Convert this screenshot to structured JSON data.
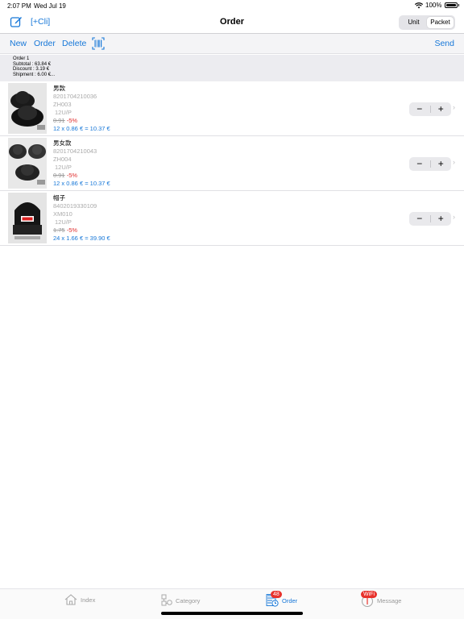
{
  "status": {
    "time": "2:07 PM",
    "date": "Wed Jul 19",
    "battery": "100%"
  },
  "nav": {
    "client_label": "[+Cli]",
    "title": "Order",
    "segments": [
      "Unit",
      "Packet"
    ],
    "selected_segment": "Packet"
  },
  "toolbar": {
    "new": "New",
    "order": "Order",
    "delete": "Delete",
    "send": "Send"
  },
  "summary": {
    "order": "Order 1",
    "subtotal": "Subtotal :   63.84 €",
    "discount": "Discount :  3.19  €",
    "shipment": "Shipment :  6.00  €..."
  },
  "items": [
    {
      "name": "男款",
      "barcode": "8201704210036",
      "ref": "ZH003",
      "pack": "12U/P",
      "old_price": "0.91",
      "discount": "-5%",
      "total": "12 x 0.86 € = 10.37 €"
    },
    {
      "name": "男女款",
      "barcode": "8201704210043",
      "ref": "ZH004",
      "pack": "12U/P",
      "old_price": "0.91",
      "discount": "-5%",
      "total": "12 x 0.86 € = 10.37 €"
    },
    {
      "name": "帽子",
      "barcode": "8402019330109",
      "ref": "XM010",
      "pack": "12U/P",
      "old_price": "1.75",
      "discount": "-5%",
      "total": "24 x 1.66 € = 39.90 €"
    }
  ],
  "stepper": {
    "minus": "−",
    "plus": "+"
  },
  "tabs": {
    "index": "Index",
    "category": "Category",
    "order": "Order",
    "order_badge": "48",
    "message": "Message",
    "message_badge": "WiFi"
  },
  "colors": {
    "accent": "#1677d8",
    "discount": "#e03030",
    "badge": "#e8322c"
  }
}
